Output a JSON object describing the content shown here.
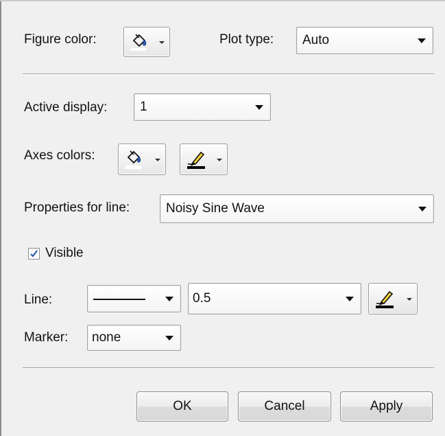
{
  "figure_color": {
    "label": "Figure color:",
    "icon": "paint-bucket-icon"
  },
  "plot_type": {
    "label": "Plot type:",
    "value": "Auto"
  },
  "active_display": {
    "label": "Active display:",
    "value": "1"
  },
  "axes_colors": {
    "label": "Axes colors:",
    "fill_icon": "paint-bucket-icon",
    "line_icon": "pen-icon"
  },
  "properties_for_line": {
    "label": "Properties for line:",
    "value": "Noisy Sine Wave"
  },
  "visible": {
    "label": "Visible",
    "checked": true
  },
  "line": {
    "label": "Line:",
    "style_value": "solid",
    "width_value": "0.5",
    "color_icon": "pen-icon"
  },
  "marker": {
    "label": "Marker:",
    "value": "none"
  },
  "buttons": {
    "ok": "OK",
    "cancel": "Cancel",
    "apply": "Apply"
  },
  "colors": {
    "background": "#f0f0f0",
    "accent_blue": "#2b5aa8",
    "swatch_white": "#ffffff",
    "swatch_black": "#000000"
  }
}
